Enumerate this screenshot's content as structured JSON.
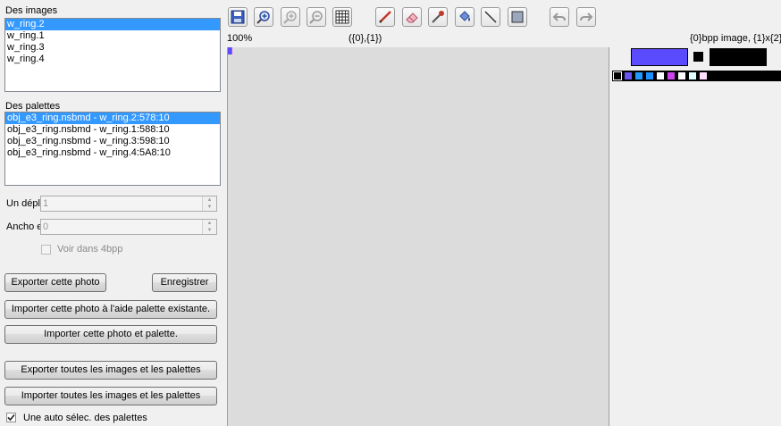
{
  "images_label": "Des images",
  "images": [
    "w_ring.2",
    "w_ring.1",
    "w_ring.3",
    "w_ring.4"
  ],
  "palettes_label": "Des palettes",
  "palettes": [
    "obj_e3_ring.nsbmd - w_ring.2:578:10",
    "obj_e3_ring.nsbmd - w_ring.1:588:10",
    "obj_e3_ring.nsbmd - w_ring.3:598:10",
    "obj_e3_ring.nsbmd - w_ring.4:5A8:10"
  ],
  "offset_label": "Un dépl",
  "offset_value": "1",
  "width_label": "Ancho e",
  "width_value": "0",
  "show4bpp_label": "Voir dans 4bpp",
  "buttons": {
    "export_photo": "Exporter cette photo",
    "save": "Enregistrer",
    "import_existing_palette": "Importer cette photo à l'aide palette existante.",
    "import_photo_palette": "Importer cette photo et palette.",
    "export_all": "Exporter toutes les images et les palettes",
    "import_all": "Importer toutes les images et les palettes"
  },
  "auto_select_label": "Une auto sélec. des palettes",
  "zoom": "100%",
  "coords": "({0},{1})",
  "image_info": "{0}bpp image, {1}x{2}",
  "colors": {
    "selected": "#5b4bff",
    "swatches": [
      "#000000",
      "#6655ee",
      "#2299ff",
      "#1e90ff",
      "#ffffff",
      "#cc44ee",
      "#ffffff",
      "#e0ffff",
      "#ffe0ff"
    ]
  },
  "toolbar_icons": [
    "save-icon",
    "zoom-in-icon",
    "zoom-in-disabled-icon",
    "zoom-out-icon",
    "grid-icon",
    "pencil-icon",
    "eraser-icon",
    "color-picker-icon",
    "fill-bucket-icon",
    "line-icon",
    "rectangle-icon",
    "undo-icon",
    "redo-icon"
  ]
}
